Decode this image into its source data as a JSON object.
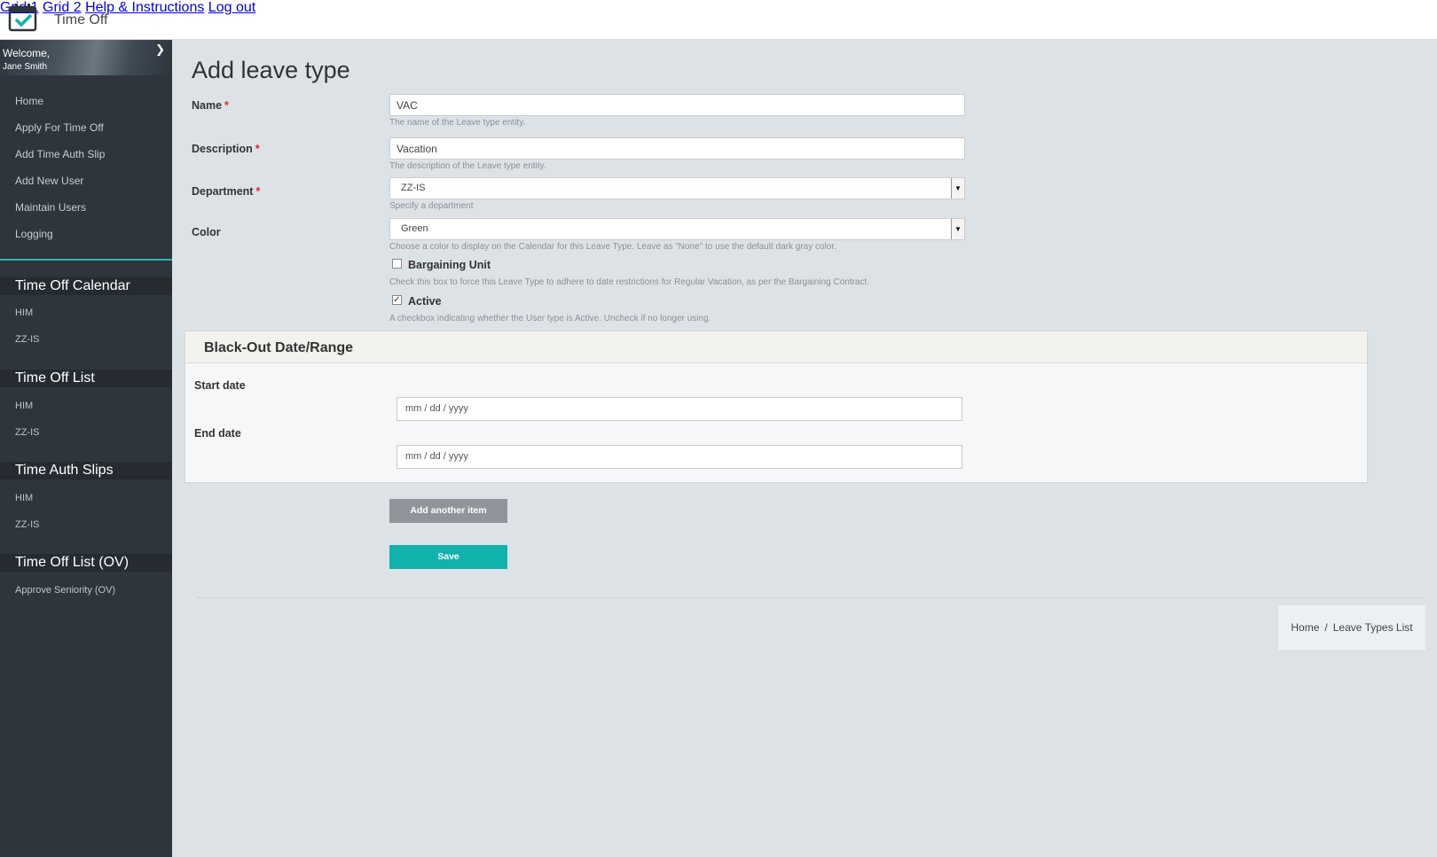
{
  "app": {
    "title": "Time Off",
    "logo_icon": "calendar-check-icon"
  },
  "topnav": [
    {
      "label": "Grid 1"
    },
    {
      "label": "Grid 2"
    },
    {
      "label": "Help & Instructions"
    },
    {
      "label": "Log out"
    }
  ],
  "sidebar": {
    "welcome": "Welcome,",
    "user_name": "Jane Smith",
    "links": [
      {
        "label": "Home"
      },
      {
        "label": "Apply For Time Off"
      },
      {
        "label": "Add Time Auth Slip"
      },
      {
        "label": "Add New User"
      },
      {
        "label": "Maintain Users"
      },
      {
        "label": "Logging"
      }
    ],
    "sections": [
      {
        "heading": "Time Off Calendar",
        "items": [
          "HIM",
          "ZZ-IS"
        ]
      },
      {
        "heading": "Time Off List",
        "items": [
          "HIM",
          "ZZ-IS"
        ]
      },
      {
        "heading": "Time Auth Slips",
        "items": [
          "HIM",
          "ZZ-IS"
        ]
      },
      {
        "heading": "Time Off List (OV)",
        "items": [
          "Approve Seniority (OV)"
        ]
      }
    ],
    "accent_color": "#1fb8b0"
  },
  "page": {
    "title": "Add leave type"
  },
  "form": {
    "name": {
      "label": "Name",
      "value": "VAC",
      "help": "The name of the Leave type entity."
    },
    "description": {
      "label": "Description",
      "value": "Vacation",
      "help": "The description of the Leave type entity."
    },
    "department": {
      "label": "Department",
      "value": "ZZ-IS",
      "help": "Specify a department"
    },
    "color": {
      "label": "Color",
      "value": "Green",
      "help": "Choose a color to display on the Calendar for this Leave Type. Leave as \"None\" to use the default dark gray color."
    },
    "bargaining": {
      "label": "Bargaining Unit",
      "checked": false,
      "help": "Check this box to force this Leave Type to adhere to date restrictions for Regular Vacation, as per the Bargaining Contract."
    },
    "active": {
      "label": "Active",
      "checked": true,
      "help": "A checkbox indicating whether the User type is Active. Uncheck if no longer using."
    },
    "required_marker": "*"
  },
  "blackout": {
    "title": "Black-Out Date/Range",
    "start_label": "Start date",
    "end_label": "End date",
    "start_placeholder": "mm / dd / yyyy",
    "end_placeholder": "mm / dd / yyyy"
  },
  "buttons": {
    "add_another": "Add another item",
    "save": "Save",
    "save_color": "#11b2ac"
  },
  "breadcrumb": {
    "home": "Home",
    "separator": "/",
    "current": "Leave Types List"
  }
}
